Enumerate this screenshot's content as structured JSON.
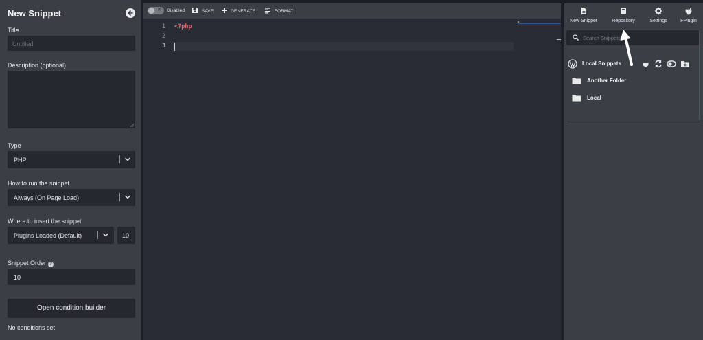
{
  "left": {
    "title": "New Snippet",
    "title_field": {
      "label": "Title",
      "placeholder": "Untitled"
    },
    "description": {
      "label": "Description (optional)"
    },
    "type": {
      "label": "Type",
      "value": "PHP"
    },
    "run": {
      "label": "How to run the snippet",
      "value": "Always (On Page Load)"
    },
    "insert": {
      "label": "Where to insert the snippet",
      "value": "Plugins Loaded (Default)",
      "priority": "10"
    },
    "order": {
      "label": "Snippet Order",
      "value": "10"
    },
    "condition_button": "Open condition builder",
    "no_conditions": "No conditions set"
  },
  "toolbar": {
    "status": "Disabled",
    "save": "SAVE",
    "generate": "GENERATE",
    "format": "FORMAT"
  },
  "editor": {
    "line_numbers": [
      "1",
      "2",
      "3"
    ],
    "code_line_1": "<?php"
  },
  "right": {
    "tabs": [
      {
        "label": "New Snippet",
        "icon": "file-icon"
      },
      {
        "label": "Repository",
        "icon": "book-icon"
      },
      {
        "label": "Settings",
        "icon": "gear-icon"
      },
      {
        "label": "FPlugin",
        "icon": "plug-icon"
      }
    ],
    "search_placeholder": "Search Snippets...",
    "local_title": "Local Snippets",
    "folders": [
      "Another Folder",
      "Local"
    ]
  }
}
